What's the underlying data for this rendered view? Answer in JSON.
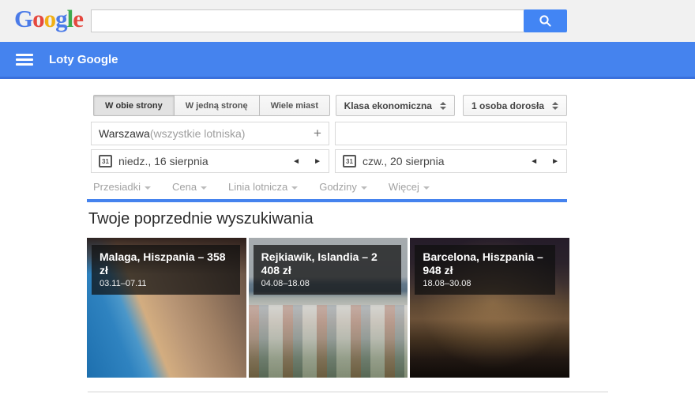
{
  "topbar": {
    "logo_letters": [
      {
        "char": "G"
      },
      {
        "char": "o"
      },
      {
        "char": "o"
      },
      {
        "char": "g"
      },
      {
        "char": "l"
      },
      {
        "char": "e"
      }
    ],
    "search_value": "",
    "search_placeholder": ""
  },
  "navbar": {
    "title": "Loty Google"
  },
  "trip_types": [
    {
      "label": "W obie strony",
      "selected": true
    },
    {
      "label": "W jedną stronę",
      "selected": false
    },
    {
      "label": "Wiele miast",
      "selected": false
    }
  ],
  "selectors": {
    "cabin_class": "Klasa ekonomiczna",
    "passengers": "1 osoba dorosła"
  },
  "route": {
    "origin": "Warszawa",
    "origin_suffix": " (wszystkie lotniska)",
    "destination": ""
  },
  "dates": {
    "departure": "niedz., 16 sierpnia",
    "return": "czw., 20 sierpnia",
    "calendar_icon_label": "31"
  },
  "filters": [
    "Przesiadki",
    "Cena",
    "Linia lotnicza",
    "Godziny",
    "Więcej"
  ],
  "section": {
    "heading": "Twoje poprzednie wyszukiwania"
  },
  "previous_searches": [
    {
      "title": "Malaga, Hiszpania – 358 zł",
      "dates": "03.11–07.11"
    },
    {
      "title": "Rejkiawik, Islandia – 2 408 zł",
      "dates": "04.08–18.08"
    },
    {
      "title": "Barcelona, Hiszpania – 948 zł",
      "dates": "18.08–30.08"
    }
  ],
  "icons": {
    "search_icon": "magnifier",
    "menu_icon": "hamburger",
    "prev_day": "◄",
    "next_day": "►",
    "add_airport": "+"
  },
  "colors": {
    "navbar_blue": "#4583ee",
    "navbar_border_blue": "#3a70dc",
    "search_button_blue": "#4285f4",
    "topbar_gray": "#f1f1f1",
    "logo_blue": "#4b7be8",
    "logo_red": "#e5483f",
    "logo_yellow": "#f1af14",
    "logo_green": "#3daa4e",
    "overlay_black": "rgba(15,15,15,0.72)"
  }
}
